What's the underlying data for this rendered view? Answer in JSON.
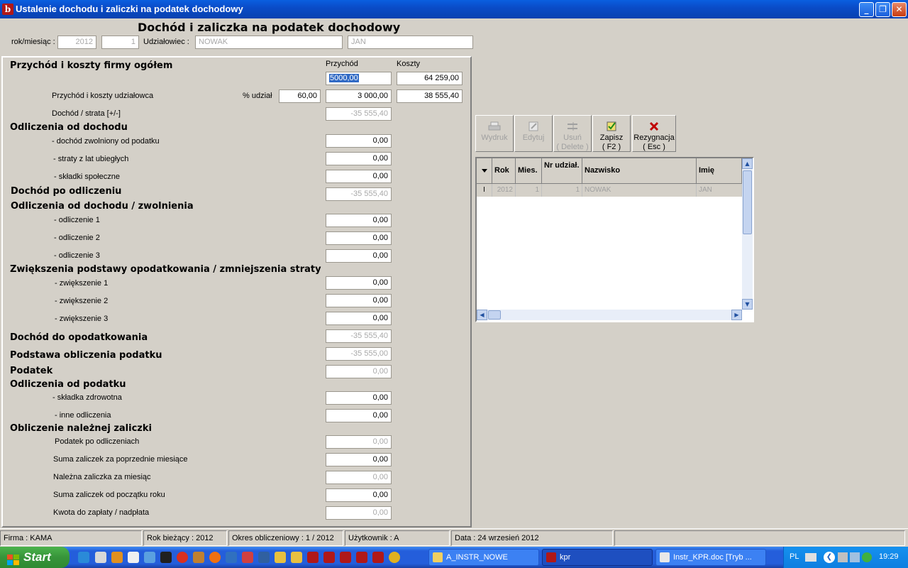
{
  "window": {
    "title": "Ustalenie dochodu i zaliczki na podatek dochodowy",
    "min_symbol": "_",
    "max_symbol": "❐",
    "close_symbol": "✕",
    "icon_letter": "b"
  },
  "header": {
    "heading": "Dochód i zaliczka na podatek dochodowy",
    "period_label": "rok/miesiąc :",
    "year": "2012",
    "month": "1",
    "shareholder_label": "Udziałowiec :",
    "last_name": "NOWAK",
    "first_name": "JAN"
  },
  "form": {
    "col_revenue": "Przychód",
    "col_costs": "Koszty",
    "company_total_label": "Przychód i koszty firmy ogółem",
    "company_revenue": "5000,00",
    "company_costs": "64 259,00",
    "shareholder_label": "Przychód i koszty udziałowca",
    "share_label": "% udział",
    "share_percent": "60,00",
    "shareholder_revenue": "3 000,00",
    "shareholder_costs": "38 555,40",
    "income_loss_label": "Dochód / strata [+/-]",
    "income_loss": "-35 555,40",
    "deductions_from_income_title": "Odliczenia od dochodu",
    "exempt_income_label": "- dochód zwolniony od podatku",
    "exempt_income": "0,00",
    "prior_losses_label": "- straty z lat ubiegłych",
    "prior_losses": "0,00",
    "social_contrib_label": "- składki społeczne",
    "social_contrib": "0,00",
    "income_after_deduction_label": "Dochód po odliczeniu",
    "income_after_deduction": "-35 555,40",
    "deductions_exemptions_title": "Odliczenia od dochodu / zwolnienia",
    "deduction1_label": "- odliczenie 1",
    "deduction1": "0,00",
    "deduction2_label": "- odliczenie 2",
    "deduction2": "0,00",
    "deduction3_label": "- odliczenie 3",
    "deduction3": "0,00",
    "increases_title": "Zwiększenia podstawy opodatkowania / zmniejszenia straty",
    "increase1_label": "- zwiększenie 1",
    "increase1": "0,00",
    "increase2_label": "- zwiększenie 2",
    "increase2": "0,00",
    "increase3_label": "- zwiększenie 3",
    "increase3": "0,00",
    "taxable_income_label": "Dochód do opodatkowania",
    "taxable_income": "-35 555,40",
    "tax_base_label": "Podstawa obliczenia podatku",
    "tax_base": "-35 555,00",
    "tax_label": "Podatek",
    "tax": "0,00",
    "tax_deductions_title": "Odliczenia od podatku",
    "health_contrib_label": "- składka zdrowotna",
    "health_contrib": "0,00",
    "other_deductions_label": "- inne odliczenia",
    "other_deductions": "0,00",
    "advance_calc_title": "Obliczenie należnej zaliczki",
    "tax_after_deductions_label": "Podatek po odliczeniach",
    "tax_after_deductions": "0,00",
    "prev_advances_label": "Suma zaliczek za poprzednie miesiące",
    "prev_advances": "0,00",
    "advance_due_label": "Należna zaliczka za miesiąc",
    "advance_due": "0,00",
    "ytd_advances_label": "Suma zaliczek od początku roku",
    "ytd_advances": "0,00",
    "amount_due_label": "Kwota do zapłaty / nadpłata",
    "amount_due": "0,00"
  },
  "toolbar": {
    "print_label": "Wydruk",
    "edit_label": "Edytuj",
    "delete_label": "Usuń",
    "delete_key": "( Delete )",
    "save_label": "Zapisz",
    "save_key": "( F2 )",
    "cancel_label": "Rezygnacja",
    "cancel_key": "( Esc )"
  },
  "grid": {
    "columns": [
      "Rok",
      "Mies.",
      "Nr udział.",
      "Nazwisko",
      "Imię"
    ],
    "row": {
      "rok": "2012",
      "mies": "1",
      "nr": "1",
      "nazwisko": "NOWAK",
      "imie": "JAN"
    }
  },
  "statusbar": {
    "firm": "Firma : KAMA",
    "current_year": "Rok bieżący : 2012",
    "period": "Okres obliczeniowy : 1 / 2012",
    "user": "Użytkownik : A",
    "date": "Data : 24 wrzesień 2012"
  },
  "taskbar": {
    "start_label": "Start",
    "tasks": [
      "A_INSTR_NOWE",
      "kpr",
      "Instr_KPR.doc [Tryb ..."
    ],
    "lang": "PL",
    "clock": "19:29"
  },
  "colors": {
    "titlebar": "#0a4cc8",
    "selection": "#316ac5",
    "delete_red": "#c00000",
    "start_green": "#37943a"
  }
}
